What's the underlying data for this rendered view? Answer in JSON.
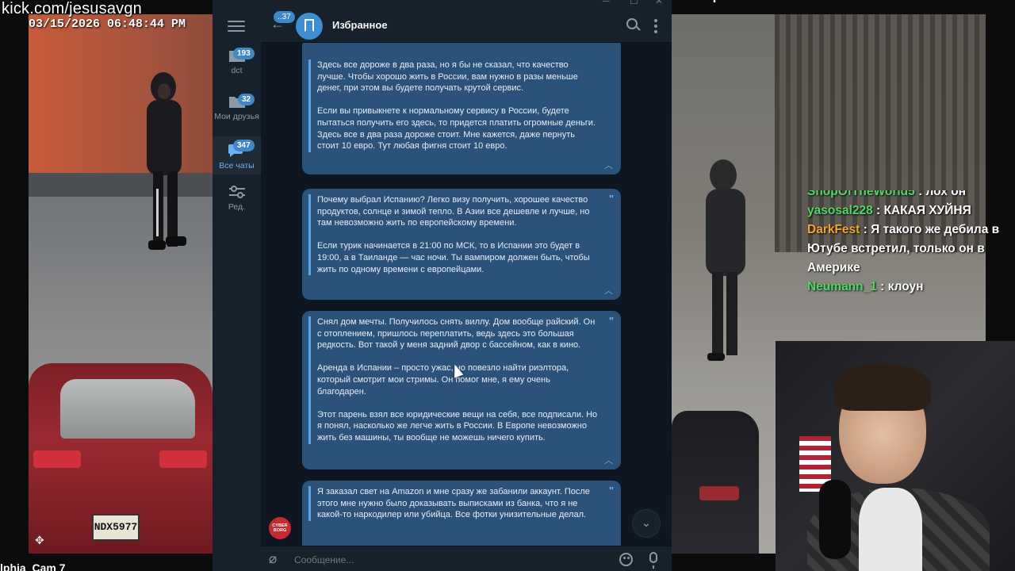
{
  "stream": {
    "url": "kick.com/jesusavgn",
    "timestamp": "03/15/2026 06:48:44 PM",
    "camera_label": "lphia_Cam 7",
    "plate": "NDX5977"
  },
  "chat": [
    {
      "user": "ShopOfTheWorld5",
      "text": " : лох он",
      "color": "#4cd964",
      "partial": true
    },
    {
      "user": "yasosal228",
      "text": " : КАКАЯ ХУЙНЯ",
      "color": "#4cd964"
    },
    {
      "user": "DarkFest",
      "text": " : Я такого же дебила в Ютубе встретил, только он в Америке",
      "color": "#f5a623"
    },
    {
      "user": "Neumann_1",
      "text": " : клоун",
      "color": "#4cd964"
    }
  ],
  "telegram": {
    "sidebar": {
      "folders": [
        {
          "label": "dct",
          "badge": "193"
        },
        {
          "label": "Мои друзья",
          "badge": "32"
        },
        {
          "label": "Все чаты",
          "badge": "347"
        },
        {
          "label": "Ред.",
          "badge": ""
        }
      ]
    },
    "header": {
      "back_badge": "37",
      "title": "Избранное"
    },
    "messages": [
      {
        "paragraphs": [
          "Здесь все дороже в два раза, но я бы не сказал, что качество лучше. Чтобы хорошо жить в России, вам нужно в разы меньше денег, при этом вы будете получать крутой сервис.",
          "Если вы привыкнете к нормальному сервису в России, будете пытаться получить его здесь, то придется платить огромные деньги. Здесь все в два раза дороже стоит. Мне кажется, даже пернуть стоит 10 евро. Тут любая фигня стоит 10 евро."
        ]
      },
      {
        "paragraphs": [
          "Почему выбрал Испанию? Легко визу получить, хорошее качество продуктов, солнце и зимой тепло. В Азии все дешевле и лучше, но там невозможно жить по европейскому времени.",
          "Если турик начинается в 21:00 по МСК, то в Испании это будет в 19:00, а в Таиланде — час ночи. Ты вампиром должен быть, чтобы жить по одному времени с европейцами."
        ]
      },
      {
        "paragraphs": [
          "Снял дом мечты. Получилось снять виллу. Дом вообще райский. Он с отоплением, пришлось переплатить, ведь здесь это большая редкость. Вот такой у меня задний двор с бассейном, как в кино.",
          "Аренда в Испании – просто ужас, но повезло найти риэлтора, который смотрит мои стримы. Он помог мне, я ему очень благодарен.",
          "Этот парень взял все юридические вещи на себя, все подписали. Но я понял, насколько же легче жить в России. В Европе невозможно жить без машины, ты вообще не можешь ничего купить."
        ]
      },
      {
        "paragraphs": [
          "Я заказал свет на Amazon и мне сразу же забанили аккаунт. После этого мне нужно было доказывать выписками из банка, что я не какой-то наркодилер или убийца. Все фотки унизительные делал."
        ]
      }
    ],
    "sender_avatar_text": "CYBER BORG",
    "compose": {
      "placeholder": "Сообщение..."
    }
  }
}
